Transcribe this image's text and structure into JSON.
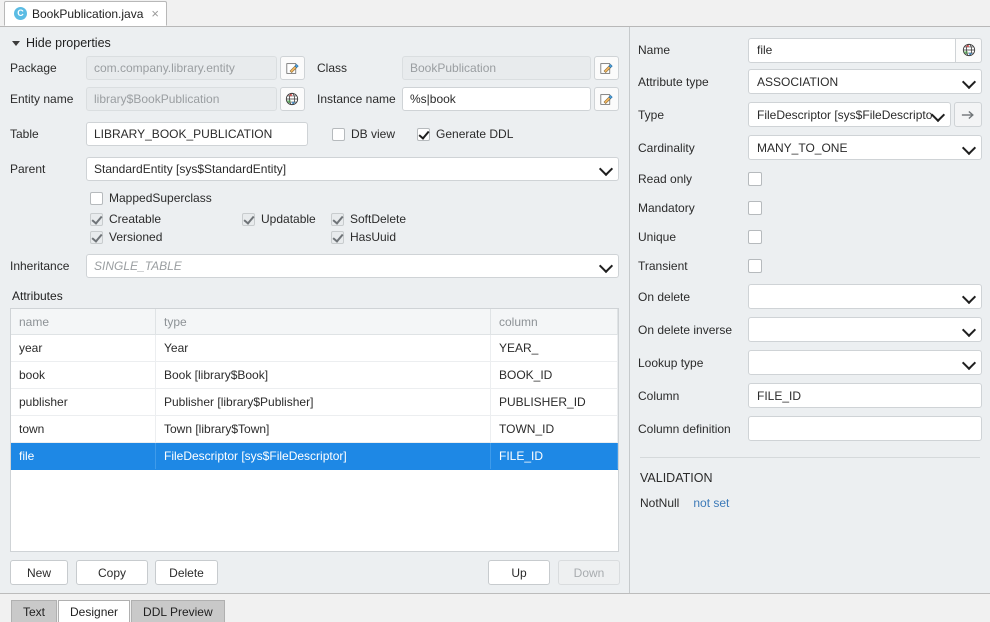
{
  "editor_tab": {
    "icon": "java-class-icon",
    "label": "BookPublication.java",
    "close": "×"
  },
  "properties_header": {
    "toggle_label": "Hide properties",
    "caret": "caret-down-icon"
  },
  "entity_form": {
    "package": {
      "label": "Package",
      "value": "com.company.library.entity",
      "button_icon": "edit-icon"
    },
    "class": {
      "label": "Class",
      "value": "BookPublication",
      "button_icon": "edit-icon"
    },
    "entity_name": {
      "label": "Entity name",
      "value": "library$BookPublication",
      "button_icon": "globe-icon"
    },
    "instance_name": {
      "label": "Instance name",
      "value": "%s|book",
      "button_icon": "edit-icon"
    },
    "table": {
      "label": "Table",
      "value": "LIBRARY_BOOK_PUBLICATION"
    },
    "db_view": {
      "label": "DB view",
      "checked": false
    },
    "generate_ddl": {
      "label": "Generate DDL",
      "checked": true
    },
    "parent": {
      "label": "Parent",
      "value": "StandardEntity [sys$StandardEntity]"
    },
    "mapped_superclass": {
      "label": "MappedSuperclass",
      "checked": false
    },
    "creatable": {
      "label": "Creatable",
      "checked": true
    },
    "updatable": {
      "label": "Updatable",
      "checked": true
    },
    "soft_delete": {
      "label": "SoftDelete",
      "checked": true
    },
    "versioned": {
      "label": "Versioned",
      "checked": true
    },
    "has_uuid": {
      "label": "HasUuid",
      "checked": true
    },
    "inheritance": {
      "label": "Inheritance",
      "value": "SINGLE_TABLE"
    }
  },
  "attributes": {
    "title": "Attributes",
    "columns": [
      "name",
      "type",
      "column"
    ],
    "rows": [
      {
        "name": "year",
        "type": "Year",
        "column": "YEAR_"
      },
      {
        "name": "book",
        "type": "Book [library$Book]",
        "column": "BOOK_ID"
      },
      {
        "name": "publisher",
        "type": "Publisher [library$Publisher]",
        "column": "PUBLISHER_ID"
      },
      {
        "name": "town",
        "type": "Town [library$Town]",
        "column": "TOWN_ID"
      },
      {
        "name": "file",
        "type": "FileDescriptor [sys$FileDescriptor]",
        "column": "FILE_ID"
      }
    ],
    "selected_index": 4
  },
  "buttons": {
    "new": "New",
    "copy": "Copy",
    "delete": "Delete",
    "up": "Up",
    "down": "Down",
    "down_disabled": true
  },
  "attribute_panel": {
    "name": {
      "label": "Name",
      "value": "file",
      "button_icon": "globe-icon"
    },
    "attribute_type": {
      "label": "Attribute type",
      "value": "ASSOCIATION"
    },
    "type": {
      "label": "Type",
      "value": "FileDescriptor [sys$FileDescripto",
      "nav_icon": "arrow-right-icon"
    },
    "cardinality": {
      "label": "Cardinality",
      "value": "MANY_TO_ONE"
    },
    "read_only": {
      "label": "Read only",
      "checked": false
    },
    "mandatory": {
      "label": "Mandatory",
      "checked": false
    },
    "unique": {
      "label": "Unique",
      "checked": false
    },
    "transient": {
      "label": "Transient",
      "checked": false
    },
    "on_delete": {
      "label": "On delete",
      "value": ""
    },
    "on_delete_inverse": {
      "label": "On delete inverse",
      "value": ""
    },
    "lookup_type": {
      "label": "Lookup type",
      "value": ""
    },
    "column": {
      "label": "Column",
      "value": "FILE_ID"
    },
    "column_definition": {
      "label": "Column definition",
      "value": ""
    },
    "validation_title": "VALIDATION",
    "not_null": {
      "label": "NotNull",
      "link": "not set"
    }
  },
  "bottom_tabs": [
    {
      "label": "Text",
      "active": false
    },
    {
      "label": "Designer",
      "active": true
    },
    {
      "label": "DDL Preview",
      "active": false
    }
  ],
  "colors": {
    "selection_blue": "#1e88e5",
    "link_blue": "#3d7ab8",
    "panel_bg": "#eceff1"
  }
}
